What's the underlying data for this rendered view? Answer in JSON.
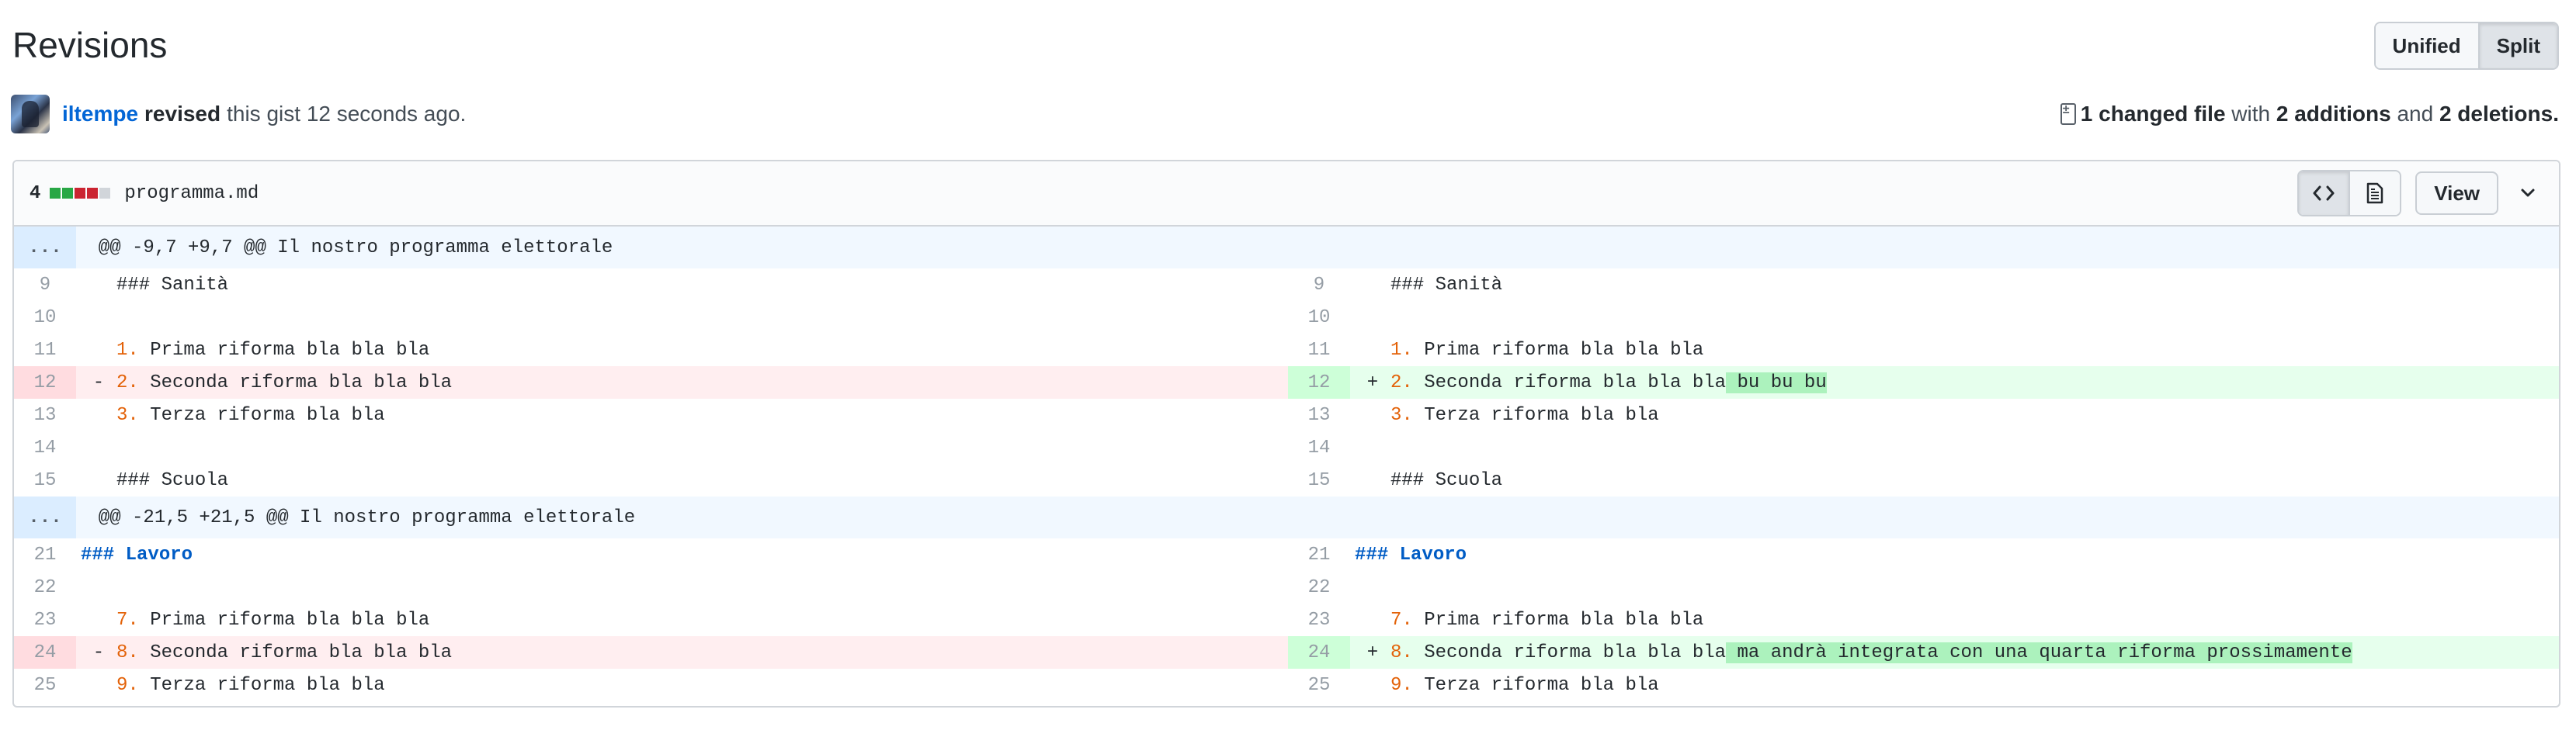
{
  "page_title": "Revisions",
  "view_toggle": {
    "unified": "Unified",
    "split": "Split",
    "active": "split"
  },
  "revision": {
    "user": "iltempe",
    "verb": "revised",
    "rest": "this gist 12 seconds ago.",
    "summary_count": "1 changed file",
    "summary_with": "with",
    "summary_add": "2 additions",
    "summary_and": "and",
    "summary_del": "2 deletions."
  },
  "file": {
    "count": "4",
    "name": "programma.md",
    "diffstat_colors": [
      "#28a745",
      "#28a745",
      "#cb2431",
      "#cb2431",
      "#d1d5da"
    ],
    "view_label": "View",
    "icons": [
      "code-icon",
      "file-text-icon",
      "chevron-down-icon"
    ]
  },
  "colors": {
    "addition_bg": "#e6ffed",
    "deletion_bg": "#ffeef0",
    "hunk_bg": "#f1f8ff",
    "link": "#0366d6"
  },
  "hunks": [
    {
      "expander": "...",
      "header": "@@ -9,7 +9,7 @@ Il nostro programma elettorale",
      "rows": [
        {
          "ln": "9",
          "lt": "### Sanità",
          "rn": "9",
          "rt": "### Sanità"
        },
        {
          "ln": "10",
          "lt": "",
          "rn": "10",
          "rt": ""
        },
        {
          "ln": "11",
          "lo": "1.",
          "lt": "Prima riforma bla bla bla",
          "rn": "11",
          "ro": "1.",
          "rt": "Prima riforma bla bla bla"
        },
        {
          "ln": "12",
          "lm": "-",
          "lo": "2.",
          "lt": "Seconda riforma bla bla bla",
          "rn": "12",
          "rm": "+",
          "ro": "2.",
          "rt": "Seconda riforma bla bla bla",
          "rhl": " bu bu bu",
          "type": "change"
        },
        {
          "ln": "13",
          "lo": "3.",
          "lt": "Terza riforma bla bla",
          "rn": "13",
          "ro": "3.",
          "rt": "Terza riforma bla bla"
        },
        {
          "ln": "14",
          "lt": "",
          "rn": "14",
          "rt": ""
        },
        {
          "ln": "15",
          "lt": "### Scuola",
          "rn": "15",
          "rt": "### Scuola"
        }
      ]
    },
    {
      "expander": "...",
      "header": "@@ -21,5 +21,5 @@ Il nostro programma elettorale",
      "rows": [
        {
          "ln": "21",
          "lh": "### Lavoro",
          "rn": "21",
          "rh": "### Lavoro"
        },
        {
          "ln": "22",
          "lt": "",
          "rn": "22",
          "rt": ""
        },
        {
          "ln": "23",
          "lo": "7.",
          "lt": "Prima riforma bla bla bla",
          "rn": "23",
          "ro": "7.",
          "rt": "Prima riforma bla bla bla"
        },
        {
          "ln": "24",
          "lm": "-",
          "lo": "8.",
          "lt": "Seconda riforma bla bla bla",
          "rn": "24",
          "rm": "+",
          "ro": "8.",
          "rt": "Seconda riforma bla bla bla",
          "rhl": " ma andrà integrata con una quarta riforma prossimamente",
          "type": "change"
        },
        {
          "ln": "25",
          "lo": "9.",
          "lt": "Terza riforma bla bla",
          "rn": "25",
          "ro": "9.",
          "rt": "Terza riforma bla bla"
        }
      ]
    }
  ]
}
